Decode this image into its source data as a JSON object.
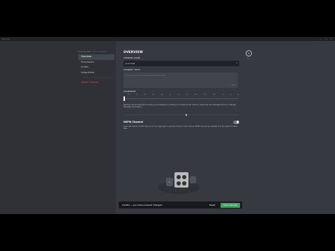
{
  "window": {
    "app_name": "Discord",
    "controls": "— □ ✕"
  },
  "sidebar": {
    "channel": "# server-chat",
    "category": "TEXT CHANNELS",
    "items": [
      {
        "label": "Overview"
      },
      {
        "label": "Permissions"
      },
      {
        "label": "Invites"
      },
      {
        "label": "Integrations"
      }
    ],
    "delete_label": "Delete Channel"
  },
  "main": {
    "title": "OVERVIEW",
    "name_label": "CHANNEL NAME",
    "name_value": "your-chat",
    "name_count": "91",
    "topic_label": "CHANNEL TOPIC",
    "topic_placeholder": "Let everyone know how to use this channel!",
    "topic_count": "1024",
    "slowmode_label": "SLOWMODE",
    "slowmode_ticks": [
      "Off",
      "5s",
      "10s",
      "15s",
      "30s",
      "1m",
      "2m",
      "5m",
      "10m",
      "15m",
      "30m",
      "1h",
      "2h",
      "6h"
    ],
    "slowmode_value": "Off",
    "slowmode_desc": "Members will be restricted to sending one message and creating one thread per this interval, unless they have Manage Channel or Manage Messages permissions.",
    "nsfw_label": "NSFW Channel",
    "nsfw_on": false,
    "nsfw_desc": "Users will need to confirm they are of over legal age to view the content in this channel. NSFW channels are exempt from the explicit content filter."
  },
  "close": {
    "icon": "close-icon",
    "esc_label": "ESC"
  },
  "savebar": {
    "message": "Careful — you have unsaved changes!",
    "reset_label": "Reset",
    "save_label": "Save Changes"
  },
  "colors": {
    "background": "#36393f",
    "sidebar": "#2f3136",
    "accent_green": "#3ba55d",
    "danger": "#ed4245"
  }
}
